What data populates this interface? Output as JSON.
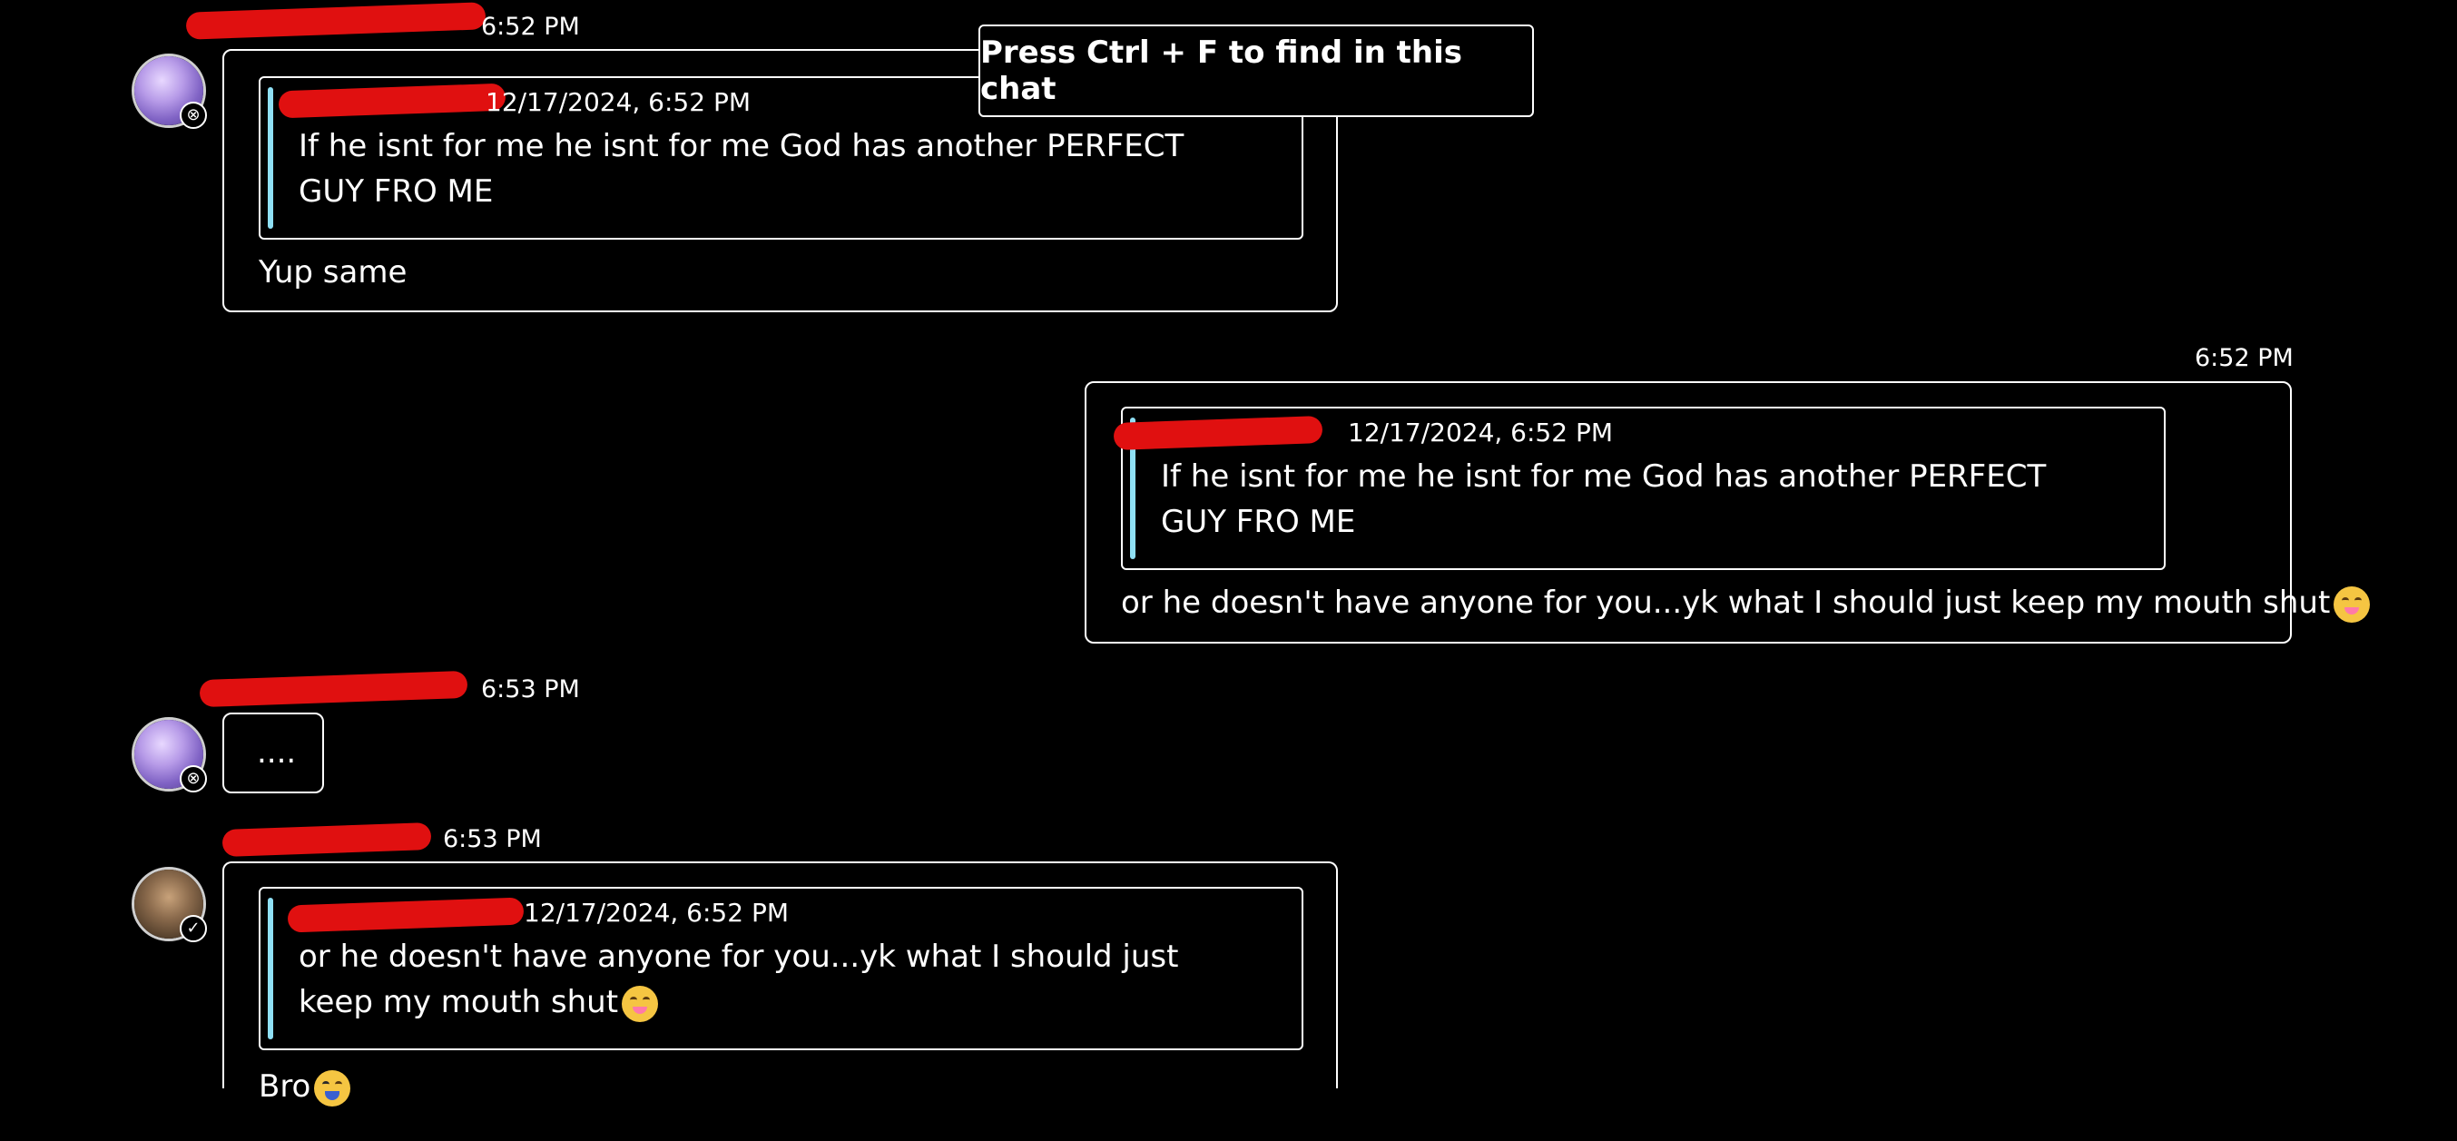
{
  "tooltip": {
    "text": "Press Ctrl + F to find in this chat"
  },
  "messages": [
    {
      "time": "6:52 PM",
      "quote": {
        "meta": "12/17/2024, 6:52 PM",
        "text": "If he isnt for me he isnt for me God has another PERFECT GUY FRO ME"
      },
      "text": "Yup same"
    },
    {
      "time": "6:52 PM",
      "quote": {
        "meta": "12/17/2024, 6:52 PM",
        "text": "If he isnt for me he isnt for me God has another PERFECT GUY FRO ME"
      },
      "text": "or he doesn't have anyone for you...yk what I should just keep my mouth shut"
    },
    {
      "time": "6:53 PM",
      "text": "...."
    },
    {
      "time": "6:53 PM",
      "quote": {
        "meta": "12/17/2024, 6:52 PM",
        "text": "or he doesn't have anyone for you...yk what I should just keep my mouth shut"
      },
      "text": "Bro"
    }
  ],
  "icons": {
    "status_blocked": "circle-x-icon",
    "status_check": "circle-check-icon",
    "emoji_zipper": "zipper-mouth-face-emoji",
    "emoji_crying": "loudly-crying-face-emoji"
  },
  "colors": {
    "background": "#000000",
    "border": "#ffffff",
    "quote_accent": "#8fe0f5",
    "redaction": "#e01010"
  }
}
